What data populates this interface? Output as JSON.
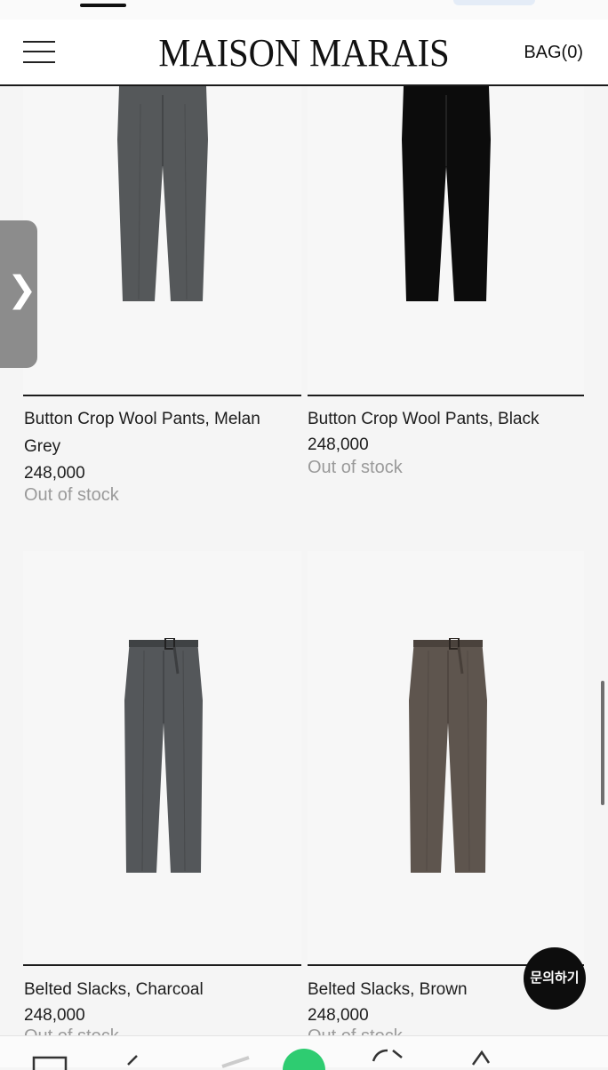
{
  "header": {
    "brand": "MAISON MARAIS",
    "bag_label": "BAG(0)",
    "menu_icon": "hamburger-menu-icon"
  },
  "products": [
    {
      "name_line1": "Button Crop Wool Pants, Melan",
      "name_line2": "Grey",
      "price": "248,000",
      "stock": "Out of stock",
      "color": "#55585a"
    },
    {
      "name_line1": "Button Crop Wool Pants, Black",
      "name_line2": "",
      "price": "248,000",
      "stock": "Out of stock",
      "color": "#0c0c0c"
    },
    {
      "name_line1": "Belted Slacks, Charcoal",
      "name_line2": "",
      "price": "248,000",
      "stock": "Out of stock",
      "color": "#54575a"
    },
    {
      "name_line1": "Belted Slacks, Brown",
      "name_line2": "",
      "price": "248,000",
      "stock": "Out of stock",
      "color": "#5e554e"
    }
  ],
  "side_handle": {
    "icon": "chevron-right-icon",
    "glyph": "❯"
  },
  "chat": {
    "label": "문의하기"
  },
  "toolbar": {
    "icons": [
      "tabs-icon",
      "back-icon",
      "home-icon",
      "refresh-icon",
      "share-icon"
    ]
  }
}
